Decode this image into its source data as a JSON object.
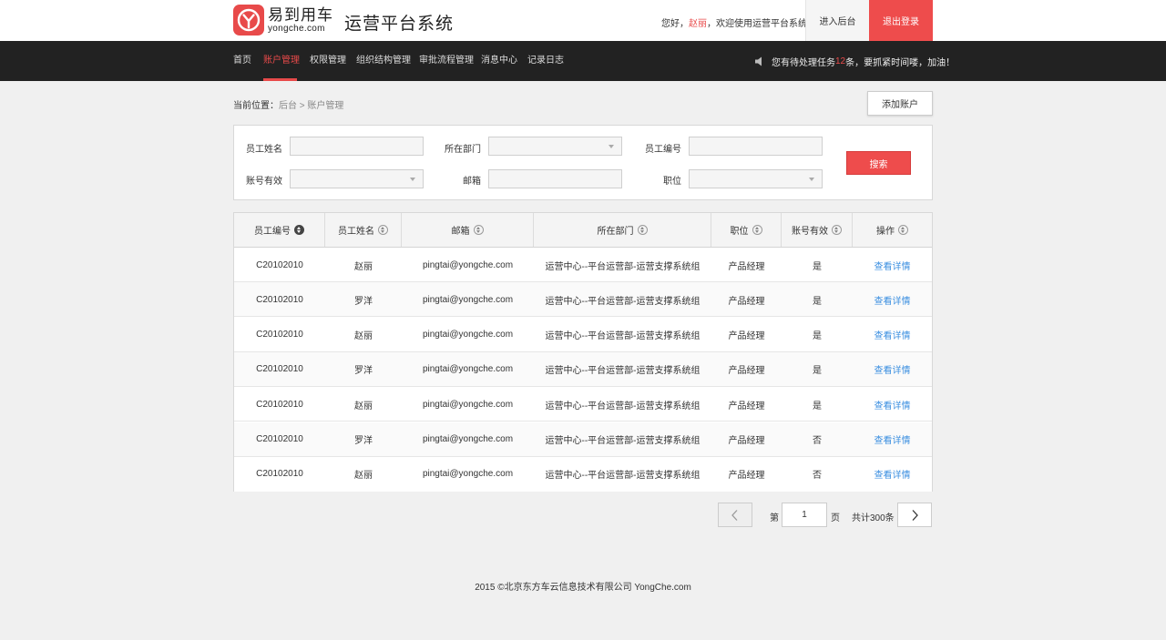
{
  "header": {
    "logo_icon": "yi-logo-icon",
    "brand_cn": "易到用车",
    "brand_en": "yongche.com",
    "system_title": "运营平台系统",
    "greeting_prefix": "您好，",
    "user_name": "赵丽",
    "greeting_suffix": "，欢迎使用运营平台系统",
    "admin_button": "进入后台",
    "logout_button": "退出登录"
  },
  "nav": {
    "items": [
      "首页",
      "账户管理",
      "权限管理",
      "组织结构管理",
      "审批流程管理",
      "消息中心",
      "记录日志"
    ],
    "active_index": 1,
    "notice_icon": "speaker-icon",
    "notice_prefix": "您有待处理任务",
    "notice_count": "12",
    "notice_suffix": "条，要抓紧时间喽，加油！"
  },
  "breadcrumb": {
    "label": "当前位置：",
    "items": [
      "后台",
      "账户管理"
    ],
    "separator": ">"
  },
  "add_button": "添加账户",
  "filters": {
    "employee_name": "员工姓名",
    "department": "所在部门",
    "employee_id": "员工编号",
    "account_valid": "账号有效",
    "email": "邮箱",
    "position": "职位",
    "search_button": "搜索"
  },
  "table": {
    "columns": [
      "员工编号",
      "员工姓名",
      "邮箱",
      "所在部门",
      "职位",
      "账号有效",
      "操作"
    ],
    "rows": [
      [
        "C20102010",
        "赵丽",
        "pingtai@yongche.com",
        "运营中心--平台运营部-运营支撑系统组",
        "产品经理",
        "是",
        "查看详情"
      ],
      [
        "C20102010",
        "罗洋",
        "pingtai@yongche.com",
        "运营中心--平台运营部-运营支撑系统组",
        "产品经理",
        "是",
        "查看详情"
      ],
      [
        "C20102010",
        "赵丽",
        "pingtai@yongche.com",
        "运营中心--平台运营部-运营支撑系统组",
        "产品经理",
        "是",
        "查看详情"
      ],
      [
        "C20102010",
        "罗洋",
        "pingtai@yongche.com",
        "运营中心--平台运营部-运营支撑系统组",
        "产品经理",
        "是",
        "查看详情"
      ],
      [
        "C20102010",
        "赵丽",
        "pingtai@yongche.com",
        "运营中心--平台运营部-运营支撑系统组",
        "产品经理",
        "是",
        "查看详情"
      ],
      [
        "C20102010",
        "罗洋",
        "pingtai@yongche.com",
        "运营中心--平台运营部-运营支撑系统组",
        "产品经理",
        "否",
        "查看详情"
      ],
      [
        "C20102010",
        "赵丽",
        "pingtai@yongche.com",
        "运营中心--平台运营部-运营支撑系统组",
        "产品经理",
        "否",
        "查看详情"
      ]
    ]
  },
  "pagination": {
    "prefix": "第",
    "current_page": "1",
    "suffix": "页",
    "total": "共计300条",
    "prev_icon": "chevron-left-icon",
    "next_icon": "chevron-right-icon"
  },
  "footer": "2015 ©北京东方车云信息技术有限公司 YongChe.com",
  "colors": {
    "accent": "#ee4c4c",
    "nav_bg": "#222222",
    "link": "#3b8fe0"
  }
}
